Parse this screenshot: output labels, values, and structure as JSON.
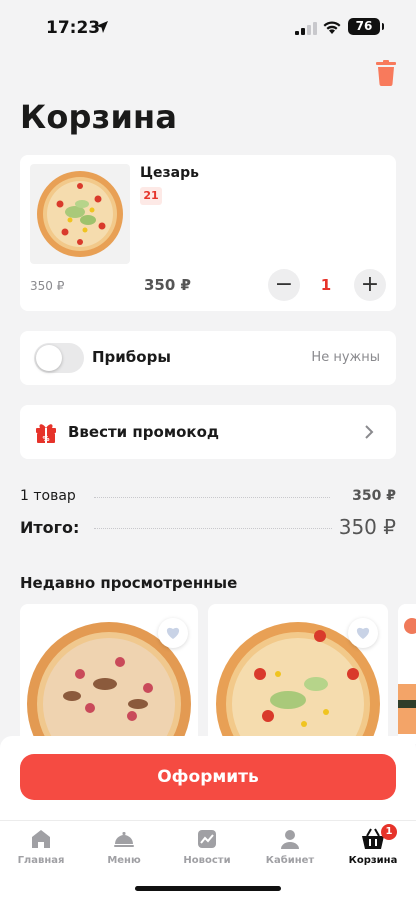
{
  "status_bar": {
    "time": "17:23",
    "battery": "76"
  },
  "page": {
    "title": "Корзина"
  },
  "cart_item": {
    "name": "Цезарь",
    "code": "21",
    "unit_price": "350 ₽",
    "total_price": "350 ₽",
    "quantity": "1",
    "minus": "−",
    "plus": "+"
  },
  "cutlery": {
    "label": "Приборы",
    "value": "Не нужны",
    "enabled": false
  },
  "promo": {
    "label": "Ввести промокод"
  },
  "summary": {
    "items_label": "1 товар",
    "items_value": "350 ₽",
    "total_label": "Итого:",
    "total_value": "350 ₽"
  },
  "recent": {
    "title": "Недавно просмотренные"
  },
  "checkout": {
    "label": "Оформить"
  },
  "tabbar": {
    "items": [
      {
        "label": "Главная",
        "icon": "home-icon"
      },
      {
        "label": "Меню",
        "icon": "cloche-icon"
      },
      {
        "label": "Новости",
        "icon": "news-icon"
      },
      {
        "label": "Кабинет",
        "icon": "profile-icon"
      },
      {
        "label": "Корзина",
        "icon": "basket-icon",
        "badge": "1",
        "active": true
      }
    ]
  },
  "colors": {
    "accent": "#f54b42",
    "red": "#e6332a",
    "background": "#f3f3f4"
  }
}
